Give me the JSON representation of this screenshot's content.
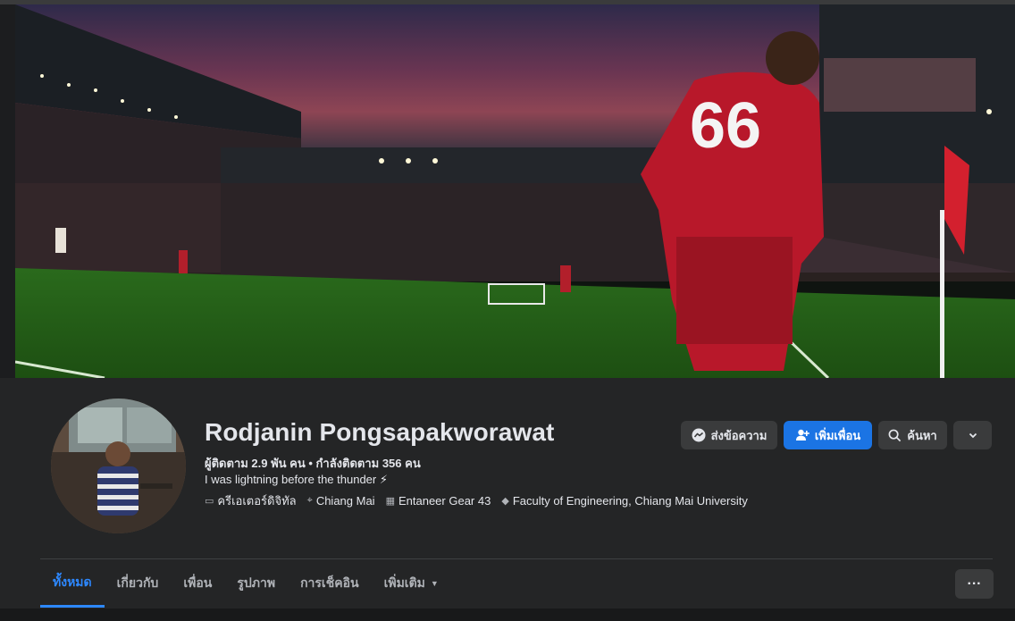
{
  "profile": {
    "name": "Rodjanin Pongsapakworawat",
    "stats": "ผู้ติดตาม 2.9 พัน คน • กำลังติดตาม 356 คน",
    "bio": "I was lightning before the thunder ⚡",
    "details": [
      {
        "icon": "briefcase-icon",
        "text": "ครีเอเตอร์ดิจิทัล"
      },
      {
        "icon": "location-pin-icon",
        "text": "Chiang Mai"
      },
      {
        "icon": "building-icon",
        "text": "Entaneer Gear 43"
      },
      {
        "icon": "graduation-cap-icon",
        "text": "Faculty of Engineering, Chiang Mai University"
      }
    ]
  },
  "cover": {
    "jersey_number": "66"
  },
  "actions": {
    "message_label": "ส่งข้อความ",
    "add_friend_label": "เพิ่มเพื่อน",
    "search_label": "ค้นหา"
  },
  "tabs": [
    {
      "label": "ทั้งหมด",
      "active": true
    },
    {
      "label": "เกี่ยวกับ",
      "active": false
    },
    {
      "label": "เพื่อน",
      "active": false
    },
    {
      "label": "รูปภาพ",
      "active": false
    },
    {
      "label": "การเช็คอิน",
      "active": false
    },
    {
      "label": "เพิ่มเติม",
      "active": false
    }
  ],
  "more_options": "···",
  "colors": {
    "accent": "#1b74e4",
    "active_tab": "#2d88ff",
    "background": "#242526"
  }
}
